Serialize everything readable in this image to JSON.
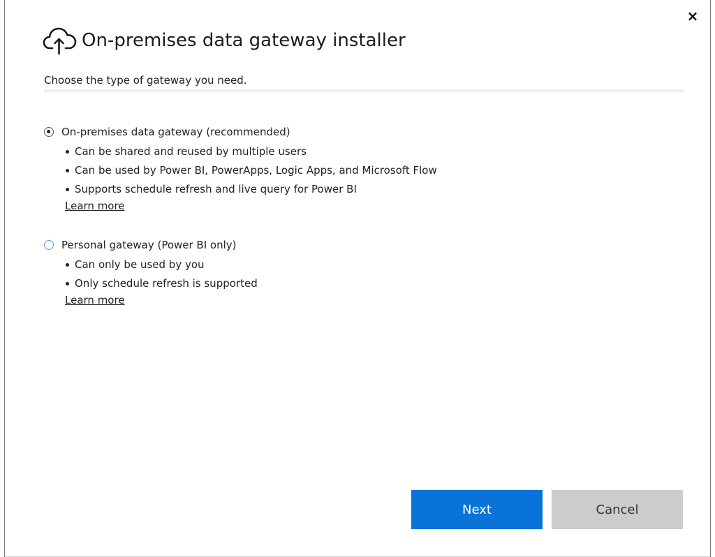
{
  "dialog": {
    "close_label": "×",
    "title": "On-premises data gateway installer",
    "title_icon": "cloud-upload-icon",
    "subtitle": "Choose the type of gateway you need."
  },
  "options": [
    {
      "label": "On-premises data gateway (recommended)",
      "selected": true,
      "bullets": [
        "Can be shared and reused by multiple users",
        "Can be used by Power BI, PowerApps, Logic Apps, and Microsoft Flow",
        "Supports schedule refresh and live query for Power BI"
      ],
      "link": "Learn more"
    },
    {
      "label": "Personal gateway (Power BI only)",
      "selected": false,
      "bullets": [
        "Can only be used by you",
        "Only schedule refresh is supported"
      ],
      "link": "Learn more"
    }
  ],
  "buttons": {
    "next_label": "Next",
    "cancel_label": "Cancel"
  },
  "colors": {
    "primary_button": "#0a73d9",
    "secondary_button": "#cccccc",
    "unselected_radio": "#5b9bd5"
  }
}
